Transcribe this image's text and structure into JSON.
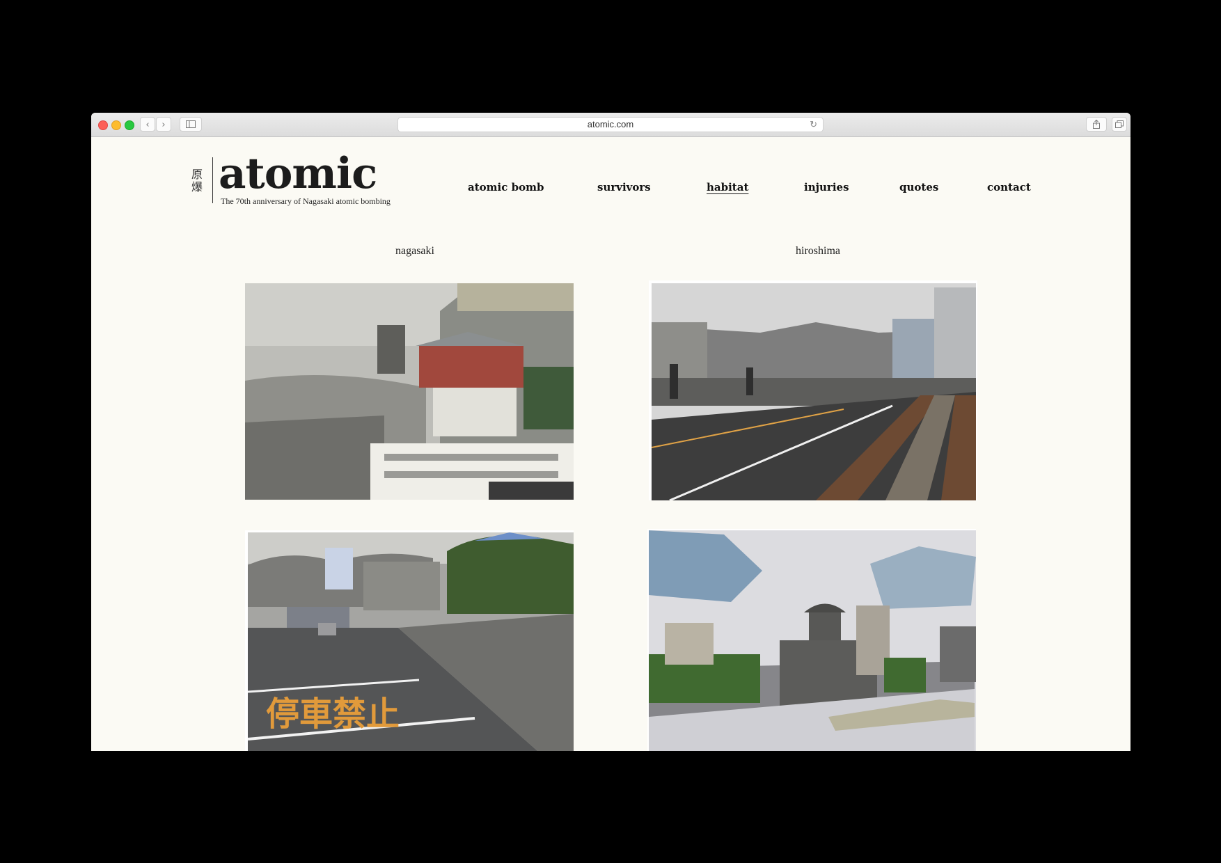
{
  "browser": {
    "url": "atomic.com",
    "back_icon": "chevron-left-icon",
    "forward_icon": "chevron-right-icon",
    "sidebar_icon": "sidebar-icon",
    "reload_icon": "reload-icon",
    "share_icon": "share-icon",
    "tabs_icon": "tabs-icon"
  },
  "logo": {
    "kanji_top": "原",
    "kanji_bottom": "爆",
    "word": "atomic",
    "tagline": "The 70th anniversary of Nagasaki atomic bombing"
  },
  "nav": {
    "items": [
      {
        "label": "atomic bomb"
      },
      {
        "label": "survivors"
      },
      {
        "label": "habitat",
        "active": true
      },
      {
        "label": "injuries"
      },
      {
        "label": "quotes"
      },
      {
        "label": "contact"
      }
    ]
  },
  "gallery": {
    "left_title": "nagasaki",
    "right_title": "hiroshima",
    "road_marking": "停車禁止"
  },
  "colors": {
    "page_background": "#fbfaf4",
    "frame_background": "#000000",
    "text": "#1c1c1c"
  }
}
